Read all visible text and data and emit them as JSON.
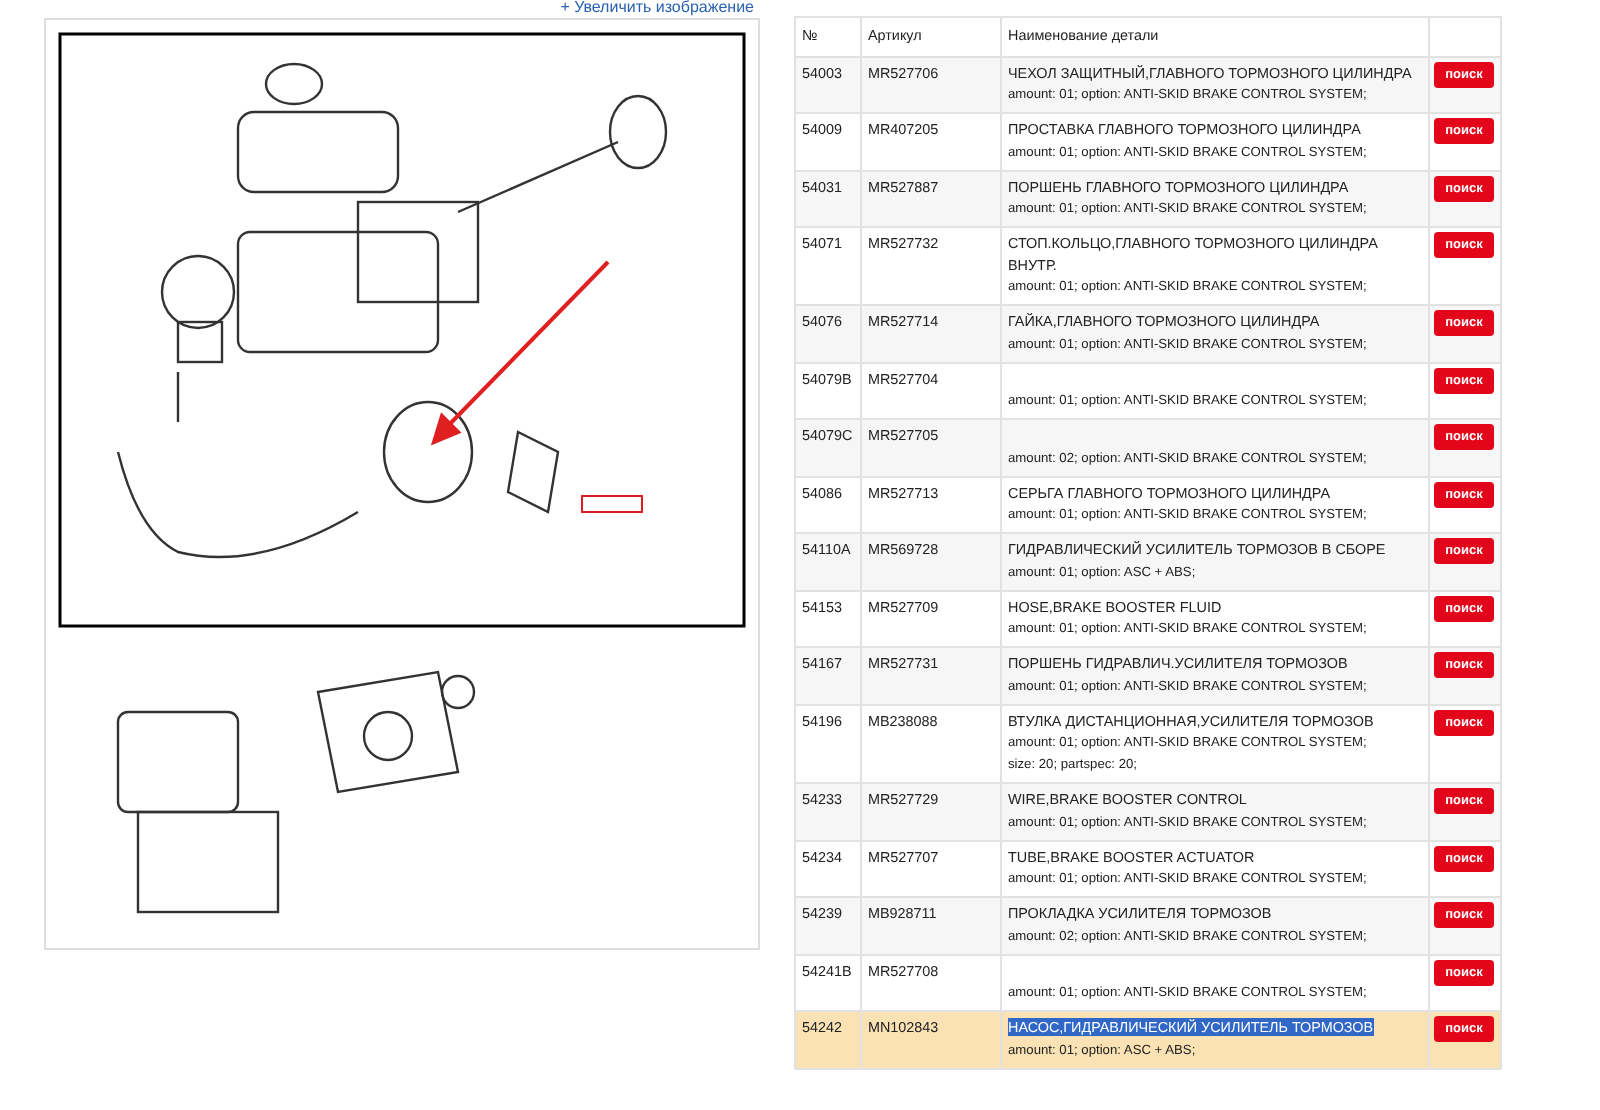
{
  "enlarge_link": "+ Увеличить изображение",
  "table": {
    "columns": [
      "№",
      "Артикул",
      "Наименование детали"
    ],
    "rows": [
      {
        "number": "54003",
        "article": "MR527706",
        "name": "ЧЕХОЛ ЗАЩИТНЫЙ,ГЛАВНОГО ТОРМОЗНОГО ЦИЛИНДРА",
        "details": [
          "amount: 01; option: ANTI-SKID BRAKE CONTROL SYSTEM;"
        ],
        "button": "поиск",
        "selected": false
      },
      {
        "number": "54009",
        "article": "MR407205",
        "name": "ПРОСТАВКА ГЛАВНОГО ТОРМОЗНОГО ЦИЛИНДРА",
        "details": [
          "amount: 01; option: ANTI-SKID BRAKE CONTROL SYSTEM;"
        ],
        "button": "поиск",
        "selected": false
      },
      {
        "number": "54031",
        "article": "MR527887",
        "name": "ПОРШЕНЬ ГЛАВНОГО ТОРМОЗНОГО ЦИЛИНДРА",
        "details": [
          "amount: 01; option: ANTI-SKID BRAKE CONTROL SYSTEM;"
        ],
        "button": "поиск",
        "selected": false
      },
      {
        "number": "54071",
        "article": "MR527732",
        "name": "СТОП.КОЛЬЦО,ГЛАВНОГО ТОРМОЗНОГО ЦИЛИНДРА ВНУТР.",
        "details": [
          "amount: 01; option: ANTI-SKID BRAKE CONTROL SYSTEM;"
        ],
        "button": "поиск",
        "selected": false
      },
      {
        "number": "54076",
        "article": "MR527714",
        "name": "ГАЙКА,ГЛАВНОГО ТОРМОЗНОГО ЦИЛИНДРА",
        "details": [
          "amount: 01; option: ANTI-SKID BRAKE CONTROL SYSTEM;"
        ],
        "button": "поиск",
        "selected": false
      },
      {
        "number": "54079B",
        "article": "MR527704",
        "details": [
          "amount: 01; option: ANTI-SKID BRAKE CONTROL SYSTEM;"
        ],
        "button": "поиск",
        "selected": false
      },
      {
        "number": "54079C",
        "article": "MR527705",
        "details": [
          "amount: 02; option: ANTI-SKID BRAKE CONTROL SYSTEM;"
        ],
        "button": "поиск",
        "selected": false
      },
      {
        "number": "54086",
        "article": "MR527713",
        "name": "СЕРЬГА ГЛАВНОГО ТОРМОЗНОГО ЦИЛИНДРА",
        "details": [
          "amount: 01; option: ANTI-SKID BRAKE CONTROL SYSTEM;"
        ],
        "button": "поиск",
        "selected": false
      },
      {
        "number": "54110A",
        "article": "MR569728",
        "name": "ГИДРАВЛИЧЕСКИЙ УСИЛИТЕЛЬ ТОРМОЗОВ В СБОРЕ",
        "details": [
          "amount: 01; option: ASC + ABS;"
        ],
        "button": "поиск",
        "selected": false
      },
      {
        "number": "54153",
        "article": "MR527709",
        "name": "HOSE,BRAKE BOOSTER FLUID",
        "details": [
          "amount: 01; option: ANTI-SKID BRAKE CONTROL SYSTEM;"
        ],
        "button": "поиск",
        "selected": false
      },
      {
        "number": "54167",
        "article": "MR527731",
        "name": "ПОРШЕНЬ ГИДРАВЛИЧ.УСИЛИТЕЛЯ ТОРМОЗОВ",
        "details": [
          "amount: 01; option: ANTI-SKID BRAKE CONTROL SYSTEM;"
        ],
        "button": "поиск",
        "selected": false
      },
      {
        "number": "54196",
        "article": "MB238088",
        "name": "ВТУЛКА ДИСТАНЦИОННАЯ,УСИЛИТЕЛЯ ТОРМОЗОВ",
        "details": [
          "amount: 01; option: ANTI-SKID BRAKE CONTROL SYSTEM;",
          "size: 20; partspec: 20;"
        ],
        "button": "поиск",
        "selected": false
      },
      {
        "number": "54233",
        "article": "MR527729",
        "name": "WIRE,BRAKE BOOSTER CONTROL",
        "details": [
          "amount: 01; option: ANTI-SKID BRAKE CONTROL SYSTEM;"
        ],
        "button": "поиск",
        "selected": false
      },
      {
        "number": "54234",
        "article": "MR527707",
        "name": "TUBE,BRAKE BOOSTER ACTUATOR",
        "details": [
          "amount: 01; option: ANTI-SKID BRAKE CONTROL SYSTEM;"
        ],
        "button": "поиск",
        "selected": false
      },
      {
        "number": "54239",
        "article": "MB928711",
        "name": "ПРОКЛАДКА УСИЛИТЕЛЯ ТОРМОЗОВ",
        "details": [
          "amount: 02; option: ANTI-SKID BRAKE CONTROL SYSTEM;"
        ],
        "button": "поиск",
        "selected": false
      },
      {
        "number": "54241B",
        "article": "MR527708",
        "details": [
          "amount: 01; option: ANTI-SKID BRAKE CONTROL SYSTEM;"
        ],
        "button": "поиск",
        "selected": false
      },
      {
        "number": "54242",
        "article": "MN102843",
        "name": "НАСОС,ГИДРАВЛИЧЕСКИЙ УСИЛИТЕЛЬ ТОРМОЗОВ",
        "details": [
          "amount: 01; option: ASC + ABS;"
        ],
        "button": "поиск",
        "selected": true
      }
    ]
  }
}
